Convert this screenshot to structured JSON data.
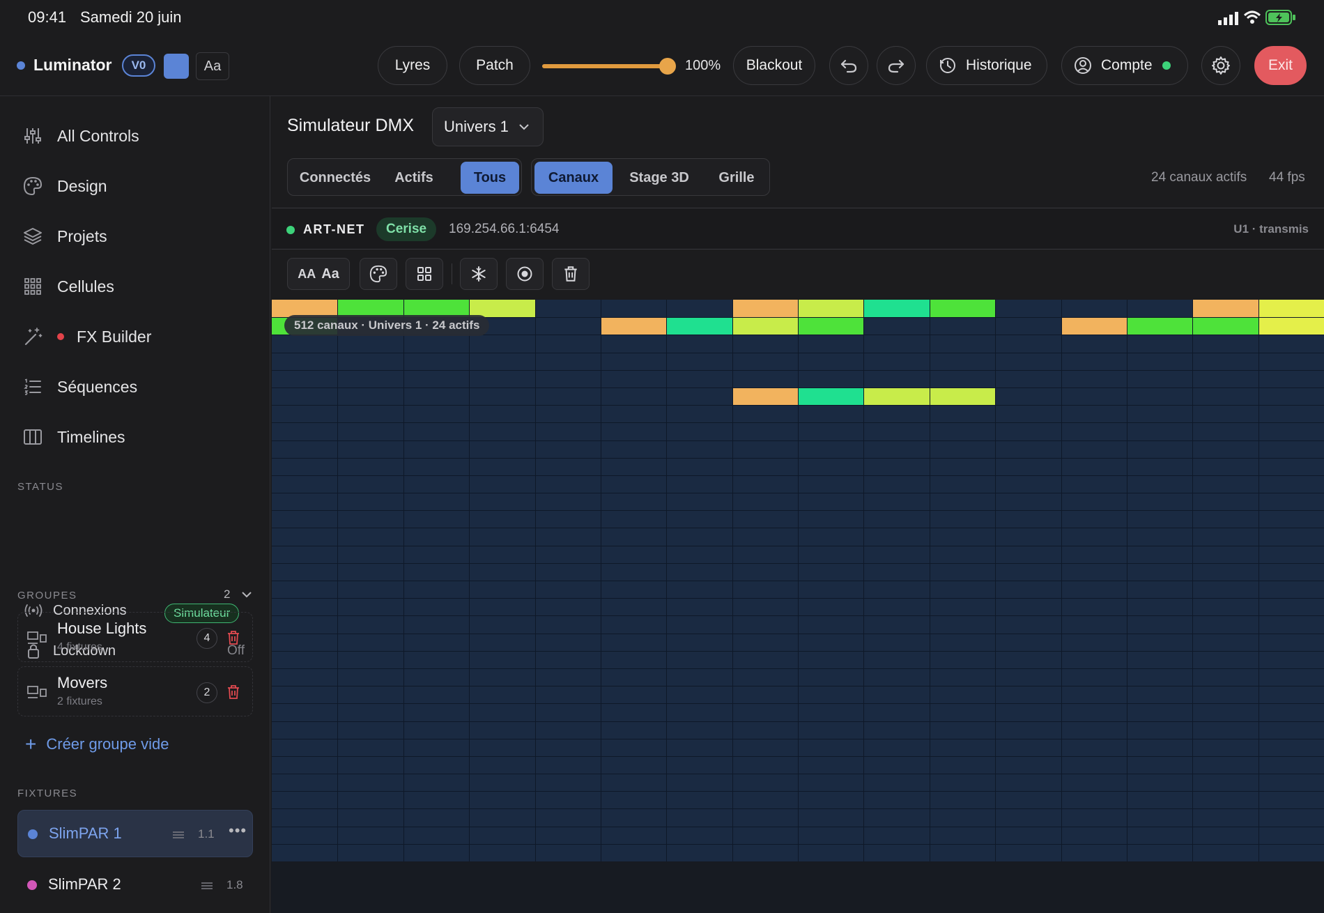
{
  "status_bar": {
    "time": "09:41",
    "date": "Samedi 20 juin"
  },
  "topbar": {
    "app_name": "Luminator",
    "version_badge": "V0",
    "font_toggle": "Aa",
    "buttons": {
      "lyres": "Lyres",
      "patch": "Patch",
      "blackout": "Blackout",
      "historique": "Historique",
      "compte": "Compte",
      "exit": "Exit"
    },
    "master_level_label": "100%",
    "master_level": 1.0
  },
  "sidebar": {
    "nav": [
      {
        "label": "All Controls",
        "icon": "sliders-icon"
      },
      {
        "label": "Design",
        "icon": "palette-icon"
      },
      {
        "label": "Projets",
        "icon": "layers-icon"
      },
      {
        "label": "Cellules",
        "icon": "grid-icon"
      },
      {
        "label": "FX Builder",
        "icon": "magic-wand-icon"
      },
      {
        "label": "Séquences",
        "icon": "list-icon"
      },
      {
        "label": "Timelines",
        "icon": "columns-icon"
      }
    ],
    "status_label": "STATUS",
    "connexions": {
      "label": "Connexions",
      "badge": "Simulateur"
    },
    "lockdown": {
      "label": "Lockdown",
      "value": "Off"
    },
    "groupes_label": "GROUPES",
    "groupes_count": "2",
    "groups": [
      {
        "name": "House Lights",
        "sub": "4 fixtures",
        "count": "4"
      },
      {
        "name": "Movers",
        "sub": "2 fixtures",
        "count": "2"
      }
    ],
    "create_group": "Créer groupe vide",
    "fixtures_label": "FIXTURES",
    "fixtures": [
      {
        "name": "SlimPAR 1",
        "address": "1.1",
        "color": "#5b84d6"
      },
      {
        "name": "SlimPAR 2",
        "address": "1.8",
        "color": "#d257b8"
      }
    ]
  },
  "main": {
    "title": "Simulateur DMX",
    "universe_select": "Univers 1",
    "filter_tabs": [
      "Connectés",
      "Actifs",
      "Tous"
    ],
    "view_tabs": [
      "Canaux",
      "Stage 3D",
      "Grille"
    ],
    "stats": {
      "active": "24 canaux actifs",
      "fps": "44 fps"
    },
    "protocol": {
      "name": "ART-NET",
      "node": "Cerise",
      "ip": "169.254.66.1:6454",
      "state": "U1 · transmis"
    },
    "tools": {
      "font_small": "AA",
      "font_large": "Aa"
    },
    "grid_tooltip": "512 canaux · Univers 1 · 24 actifs"
  },
  "colors": {
    "orange": "#f2b35e",
    "green": "#4ee23a",
    "teal": "#1fe090",
    "lime": "#c8ec4a",
    "yellow": "#e4ef4a",
    "cell": "#1a2a42",
    "accent": "#5b84d6",
    "exit": "#e35a5f"
  }
}
